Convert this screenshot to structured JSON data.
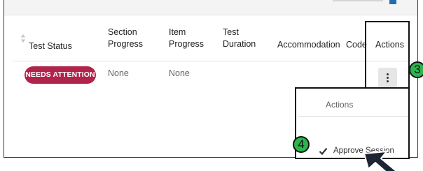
{
  "table": {
    "headers": {
      "test_status": "Test Status",
      "section_progress": [
        "Section",
        "Progress"
      ],
      "item_progress": [
        "Item",
        "Progress"
      ],
      "test_duration": [
        "Test",
        "Duration"
      ],
      "accommodation": "Accommodation",
      "code": "Code",
      "actions": "Actions"
    },
    "row": {
      "status_badge": "NEEDS ATTENTION",
      "section_progress": "None",
      "item_progress": "None"
    }
  },
  "actions_menu": {
    "header": "Actions",
    "items": [
      {
        "label": "Approve Session",
        "checked": true
      }
    ]
  },
  "annotations": {
    "step_3": "3",
    "step_4": "4"
  },
  "colors": {
    "badge": "#b0234b",
    "step_marker": "#2bb54e",
    "tab_active": "#1f6fb5"
  },
  "icons": [
    "sort-icon",
    "more-vertical-icon",
    "checkmark-icon",
    "mouse-cursor-icon"
  ]
}
